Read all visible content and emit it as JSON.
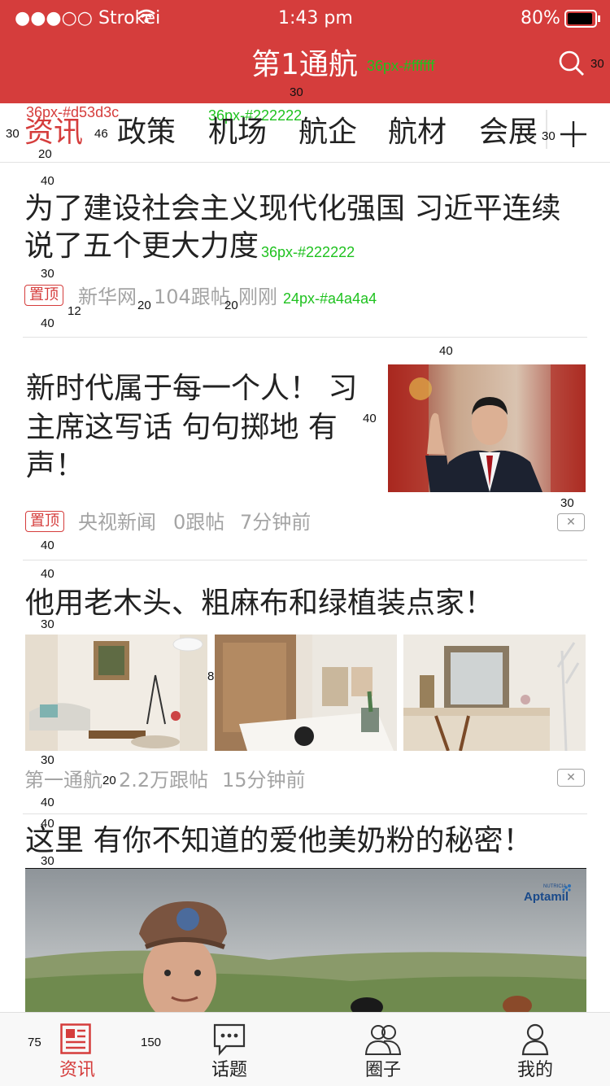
{
  "status_bar": {
    "carrier": "●●●○○ Strokei",
    "time": "1:43 pm",
    "battery": "80%"
  },
  "header": {
    "title": "第1通航",
    "title_note": "36px-#ffffff",
    "search_note": "30",
    "spacing_note": "30"
  },
  "tabs": {
    "items": [
      {
        "label": "资讯",
        "active": true
      },
      {
        "label": "政策"
      },
      {
        "label": "机场"
      },
      {
        "label": "航企"
      },
      {
        "label": "航材"
      },
      {
        "label": "会展"
      }
    ],
    "active_note": "36px-#d53d3c",
    "inactive_note": "36px-#222222",
    "left_note": "30",
    "gap_note": "46",
    "bottom_note": "20",
    "right_note": "30",
    "add_icon": "plus-icon"
  },
  "articles": [
    {
      "title_line1": "为了建设社会主义现代化强国  习近平连续",
      "title_line2": "说了五个更大力度",
      "title_note": "36px-#222222",
      "badge": "置顶",
      "source": "新华网",
      "comments": "104跟帖",
      "time": "刚刚",
      "meta_note": "24px-#a4a4a4",
      "notes": {
        "top": "40",
        "mid": "30",
        "badge_gap": "12",
        "gap1": "20",
        "gap2": "20",
        "bottom": "40"
      }
    },
    {
      "title_lines": [
        "新时代属于每一个人！ 习",
        "主席这写话  句句掷地  有",
        "声！"
      ],
      "badge": "置顶",
      "source": "央视新闻",
      "comments": "0跟帖",
      "time": "7分钟前",
      "notes": {
        "top": "40",
        "img_gap": "40",
        "img_bottom": "30",
        "bottom": "40"
      }
    },
    {
      "title": "他用老木头、粗麻布和绿植装点家！",
      "source": "第一通航",
      "comments": "2.2万跟帖",
      "time": "15分钟前",
      "notes": {
        "top": "40",
        "title_bottom": "30",
        "img_gap": "8",
        "img_bottom": "30",
        "src_gap": "20",
        "bottom": "40"
      }
    },
    {
      "title": "这里  有你不知道的爱他美奶粉的秘密！",
      "ad_brand": "Aptamil",
      "ad_brand_sub": "NUTRICIA",
      "notes": {
        "top": "40",
        "title_bottom": "30"
      }
    }
  ],
  "bottom_nav": {
    "items": [
      {
        "label": "资讯",
        "icon": "news-icon",
        "active": true
      },
      {
        "label": "话题",
        "icon": "chat-bubble-icon"
      },
      {
        "label": "圈子",
        "icon": "group-icon"
      },
      {
        "label": "我的",
        "icon": "user-icon"
      }
    ],
    "left_note": "75",
    "gap_note": "150"
  },
  "colors": {
    "accent": "#d53d3c",
    "text": "#222222",
    "meta": "#a4a4a4",
    "note": "#1fc21f"
  }
}
